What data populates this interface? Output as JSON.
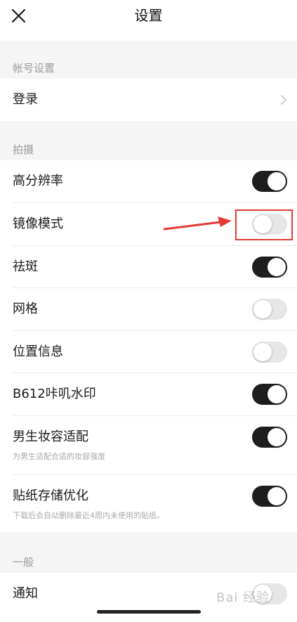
{
  "header": {
    "title": "设置"
  },
  "sections": {
    "account": {
      "label": "帐号设置",
      "login": "登录"
    },
    "shooting": {
      "label": "拍摄",
      "items": [
        {
          "title": "高分辨率",
          "on": true
        },
        {
          "title": "镜像模式",
          "on": false
        },
        {
          "title": "祛斑",
          "on": true
        },
        {
          "title": "网格",
          "on": false
        },
        {
          "title": "位置信息",
          "on": false
        },
        {
          "title": "B612咔叽水印",
          "on": true
        },
        {
          "title": "男生妆容适配",
          "subtitle": "为男生适配合适的妆容强度",
          "on": true
        },
        {
          "title": "贴纸存储优化",
          "subtitle": "下载后会自动删除最近4周内未使用的贴纸。",
          "on": true
        }
      ]
    },
    "general": {
      "label": "一般",
      "items": [
        {
          "title": "通知",
          "on": false
        }
      ]
    }
  },
  "annotation": {
    "color": "#e53935"
  },
  "watermark": "Bai 经验"
}
